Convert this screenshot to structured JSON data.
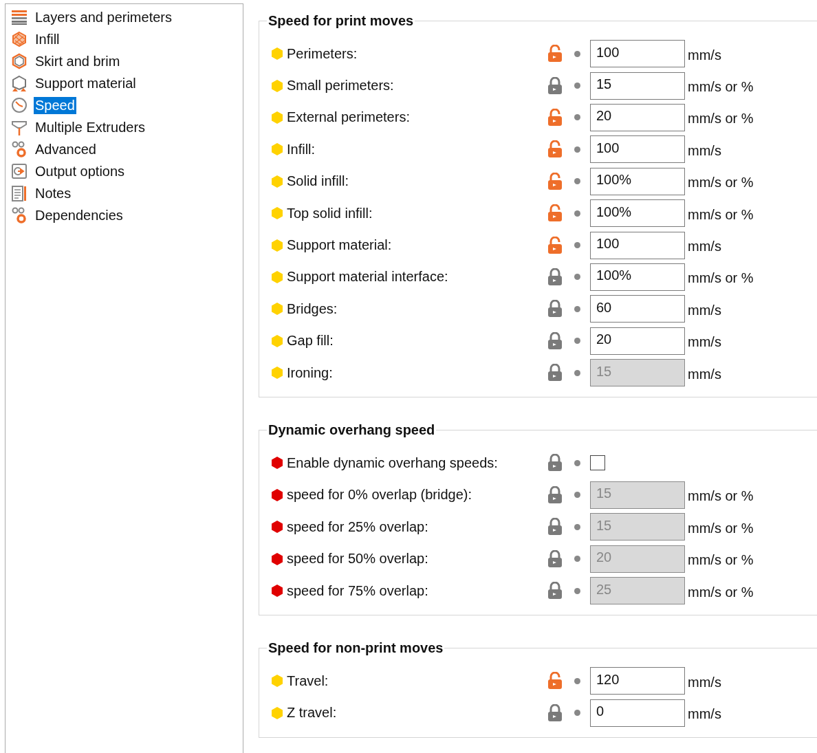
{
  "sidebar": {
    "items": [
      {
        "label": "Layers and perimeters",
        "selected": false
      },
      {
        "label": "Infill",
        "selected": false
      },
      {
        "label": "Skirt and brim",
        "selected": false
      },
      {
        "label": "Support material",
        "selected": false
      },
      {
        "label": "Speed",
        "selected": true
      },
      {
        "label": "Multiple Extruders",
        "selected": false
      },
      {
        "label": "Advanced",
        "selected": false
      },
      {
        "label": "Output options",
        "selected": false
      },
      {
        "label": "Notes",
        "selected": false
      },
      {
        "label": "Dependencies",
        "selected": false
      }
    ]
  },
  "sections": [
    {
      "title": "Speed for print moves",
      "rows": [
        {
          "label": "Perimeters:",
          "color": "#ffd200",
          "locked": false,
          "kind": "number",
          "value": "100",
          "unit": "mm/s",
          "disabled": false
        },
        {
          "label": "Small perimeters:",
          "color": "#ffd200",
          "locked": true,
          "kind": "number",
          "value": "15",
          "unit": "mm/s or %",
          "disabled": false
        },
        {
          "label": "External perimeters:",
          "color": "#ffd200",
          "locked": false,
          "kind": "number",
          "value": "20",
          "unit": "mm/s or %",
          "disabled": false
        },
        {
          "label": "Infill:",
          "color": "#ffd200",
          "locked": false,
          "kind": "number",
          "value": "100",
          "unit": "mm/s",
          "disabled": false
        },
        {
          "label": "Solid infill:",
          "color": "#ffd200",
          "locked": false,
          "kind": "number",
          "value": "100%",
          "unit": "mm/s or %",
          "disabled": false
        },
        {
          "label": "Top solid infill:",
          "color": "#ffd200",
          "locked": false,
          "kind": "number",
          "value": "100%",
          "unit": "mm/s or %",
          "disabled": false
        },
        {
          "label": "Support material:",
          "color": "#ffd200",
          "locked": false,
          "kind": "number",
          "value": "100",
          "unit": "mm/s",
          "disabled": false
        },
        {
          "label": "Support material interface:",
          "color": "#ffd200",
          "locked": true,
          "kind": "number",
          "value": "100%",
          "unit": "mm/s or %",
          "disabled": false
        },
        {
          "label": "Bridges:",
          "color": "#ffd200",
          "locked": true,
          "kind": "number",
          "value": "60",
          "unit": "mm/s",
          "disabled": false
        },
        {
          "label": "Gap fill:",
          "color": "#ffd200",
          "locked": true,
          "kind": "number",
          "value": "20",
          "unit": "mm/s",
          "disabled": false
        },
        {
          "label": "Ironing:",
          "color": "#ffd200",
          "locked": true,
          "kind": "number",
          "value": "15",
          "unit": "mm/s",
          "disabled": true
        }
      ]
    },
    {
      "title": "Dynamic overhang speed",
      "rows": [
        {
          "label": "Enable dynamic overhang speeds:",
          "color": "#e00000",
          "locked": true,
          "kind": "checkbox",
          "checked": false
        },
        {
          "label": "speed for 0% overlap (bridge):",
          "color": "#e00000",
          "locked": true,
          "kind": "number",
          "value": "15",
          "unit": "mm/s or %",
          "disabled": true
        },
        {
          "label": "speed for 25% overlap:",
          "color": "#e00000",
          "locked": true,
          "kind": "number",
          "value": "15",
          "unit": "mm/s or %",
          "disabled": true
        },
        {
          "label": "speed for 50% overlap:",
          "color": "#e00000",
          "locked": true,
          "kind": "number",
          "value": "20",
          "unit": "mm/s or %",
          "disabled": true
        },
        {
          "label": "speed for 75% overlap:",
          "color": "#e00000",
          "locked": true,
          "kind": "number",
          "value": "25",
          "unit": "mm/s or %",
          "disabled": true
        }
      ]
    },
    {
      "title": "Speed for non-print moves",
      "rows": [
        {
          "label": "Travel:",
          "color": "#ffd200",
          "locked": false,
          "kind": "number",
          "value": "120",
          "unit": "mm/s",
          "disabled": false
        },
        {
          "label": "Z travel:",
          "color": "#ffd200",
          "locked": true,
          "kind": "number",
          "value": "0",
          "unit": "mm/s",
          "disabled": false
        }
      ]
    }
  ]
}
